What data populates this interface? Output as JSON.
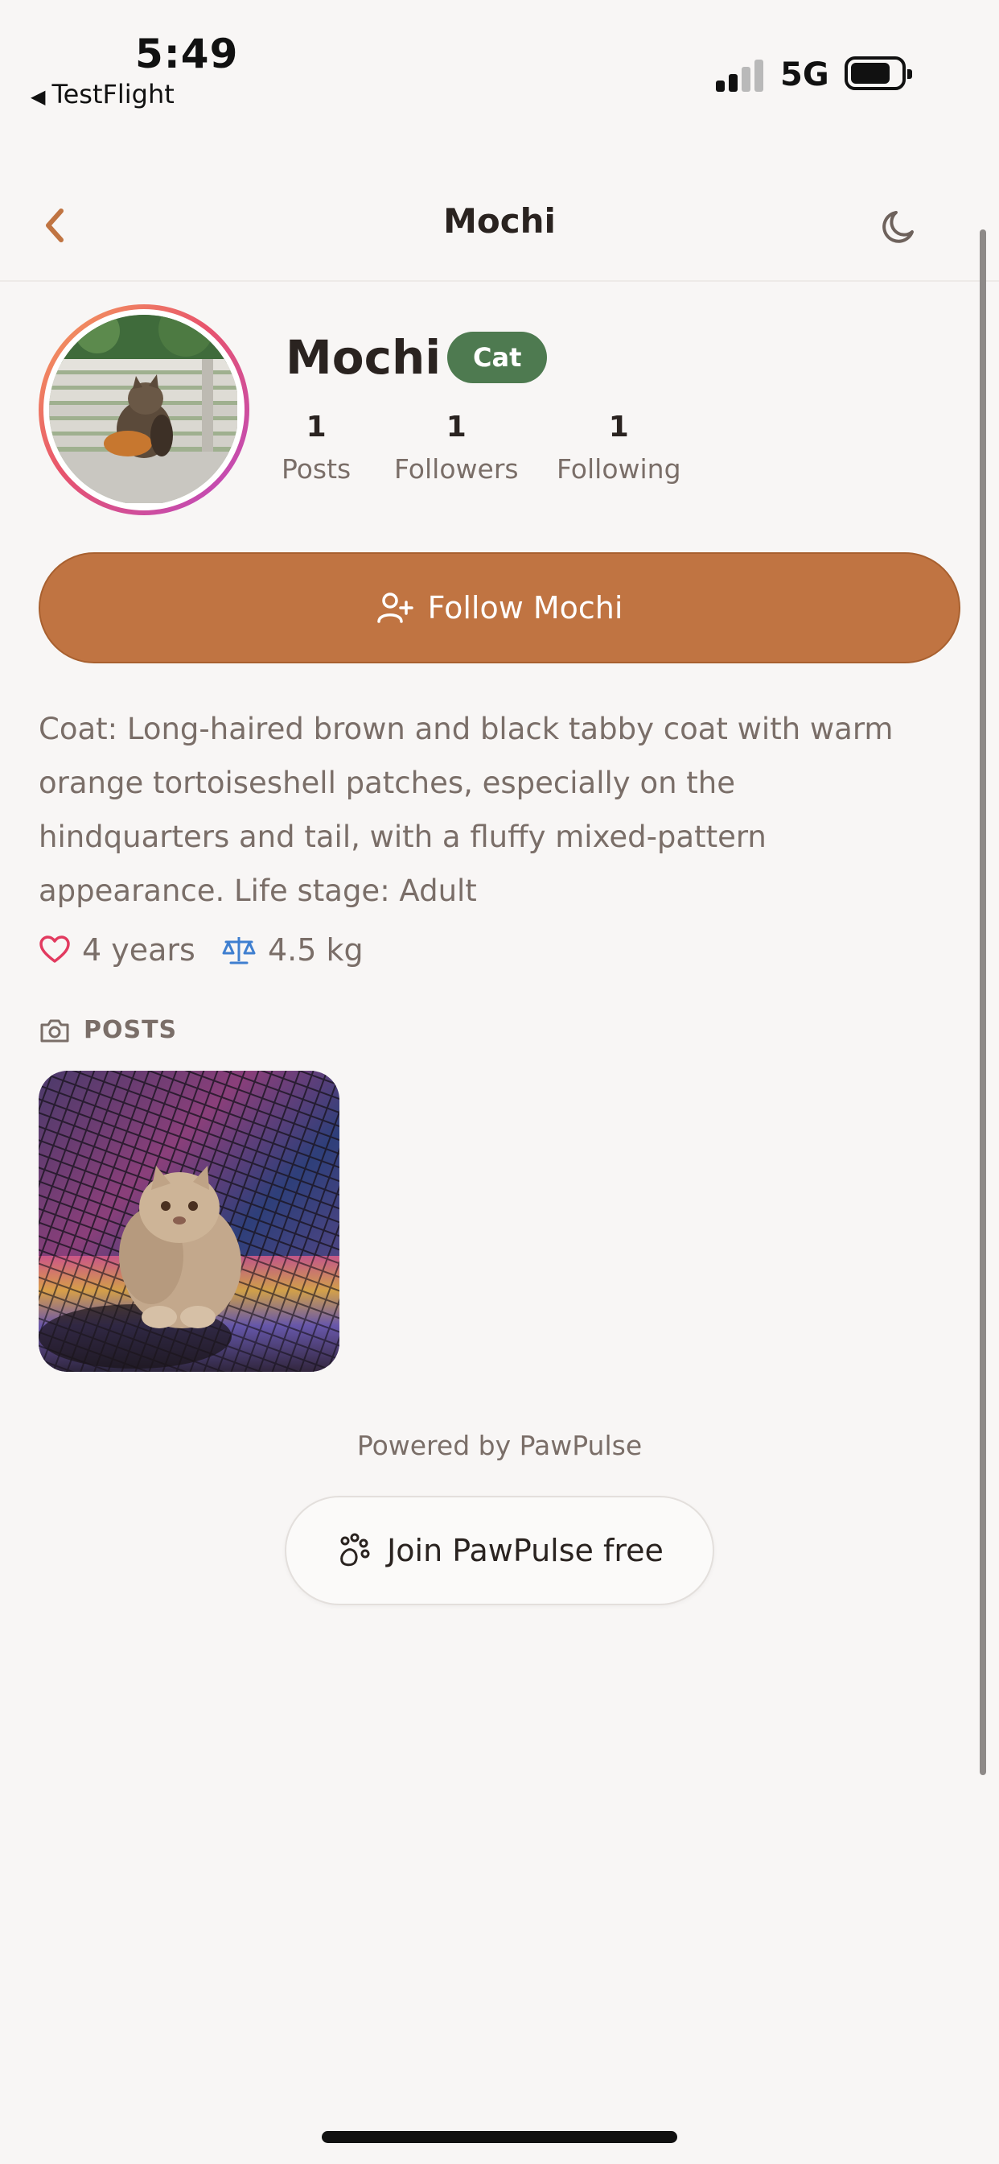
{
  "status_bar": {
    "time": "5:49",
    "back_app": "TestFlight",
    "network": "5G"
  },
  "nav": {
    "title": "Mochi"
  },
  "profile": {
    "name": "Mochi",
    "species": "Cat",
    "stats": [
      {
        "value": "1",
        "label": "Posts"
      },
      {
        "value": "1",
        "label": "Followers"
      },
      {
        "value": "1",
        "label": "Following"
      }
    ],
    "follow_label": "Follow Mochi",
    "bio_lines": [
      "Coat: Long-haired brown and black tabby coat with warm",
      "orange tortoiseshell patches, especially on the",
      "hindquarters and tail, with a fluffy mixed-pattern",
      "appearance. Life stage: Adult"
    ],
    "age": "4 years",
    "weight": "4.5 kg"
  },
  "posts_section": {
    "title": "POSTS"
  },
  "footer": {
    "powered_by": "Powered by PawPulse",
    "join_label": "Join PawPulse free"
  },
  "colors": {
    "accent": "#c07442",
    "badge": "#4e7a50",
    "background": "#f8f6f5",
    "muted_text": "#7a6e68",
    "heart": "#e23a5f",
    "scale": "#3f7fd0"
  },
  "icons": {
    "back": "chevron-left-icon",
    "theme": "moon-icon",
    "follow": "user-plus-icon",
    "age": "heart-icon",
    "weight": "scale-icon",
    "posts": "camera-icon",
    "join": "paw-icon"
  }
}
